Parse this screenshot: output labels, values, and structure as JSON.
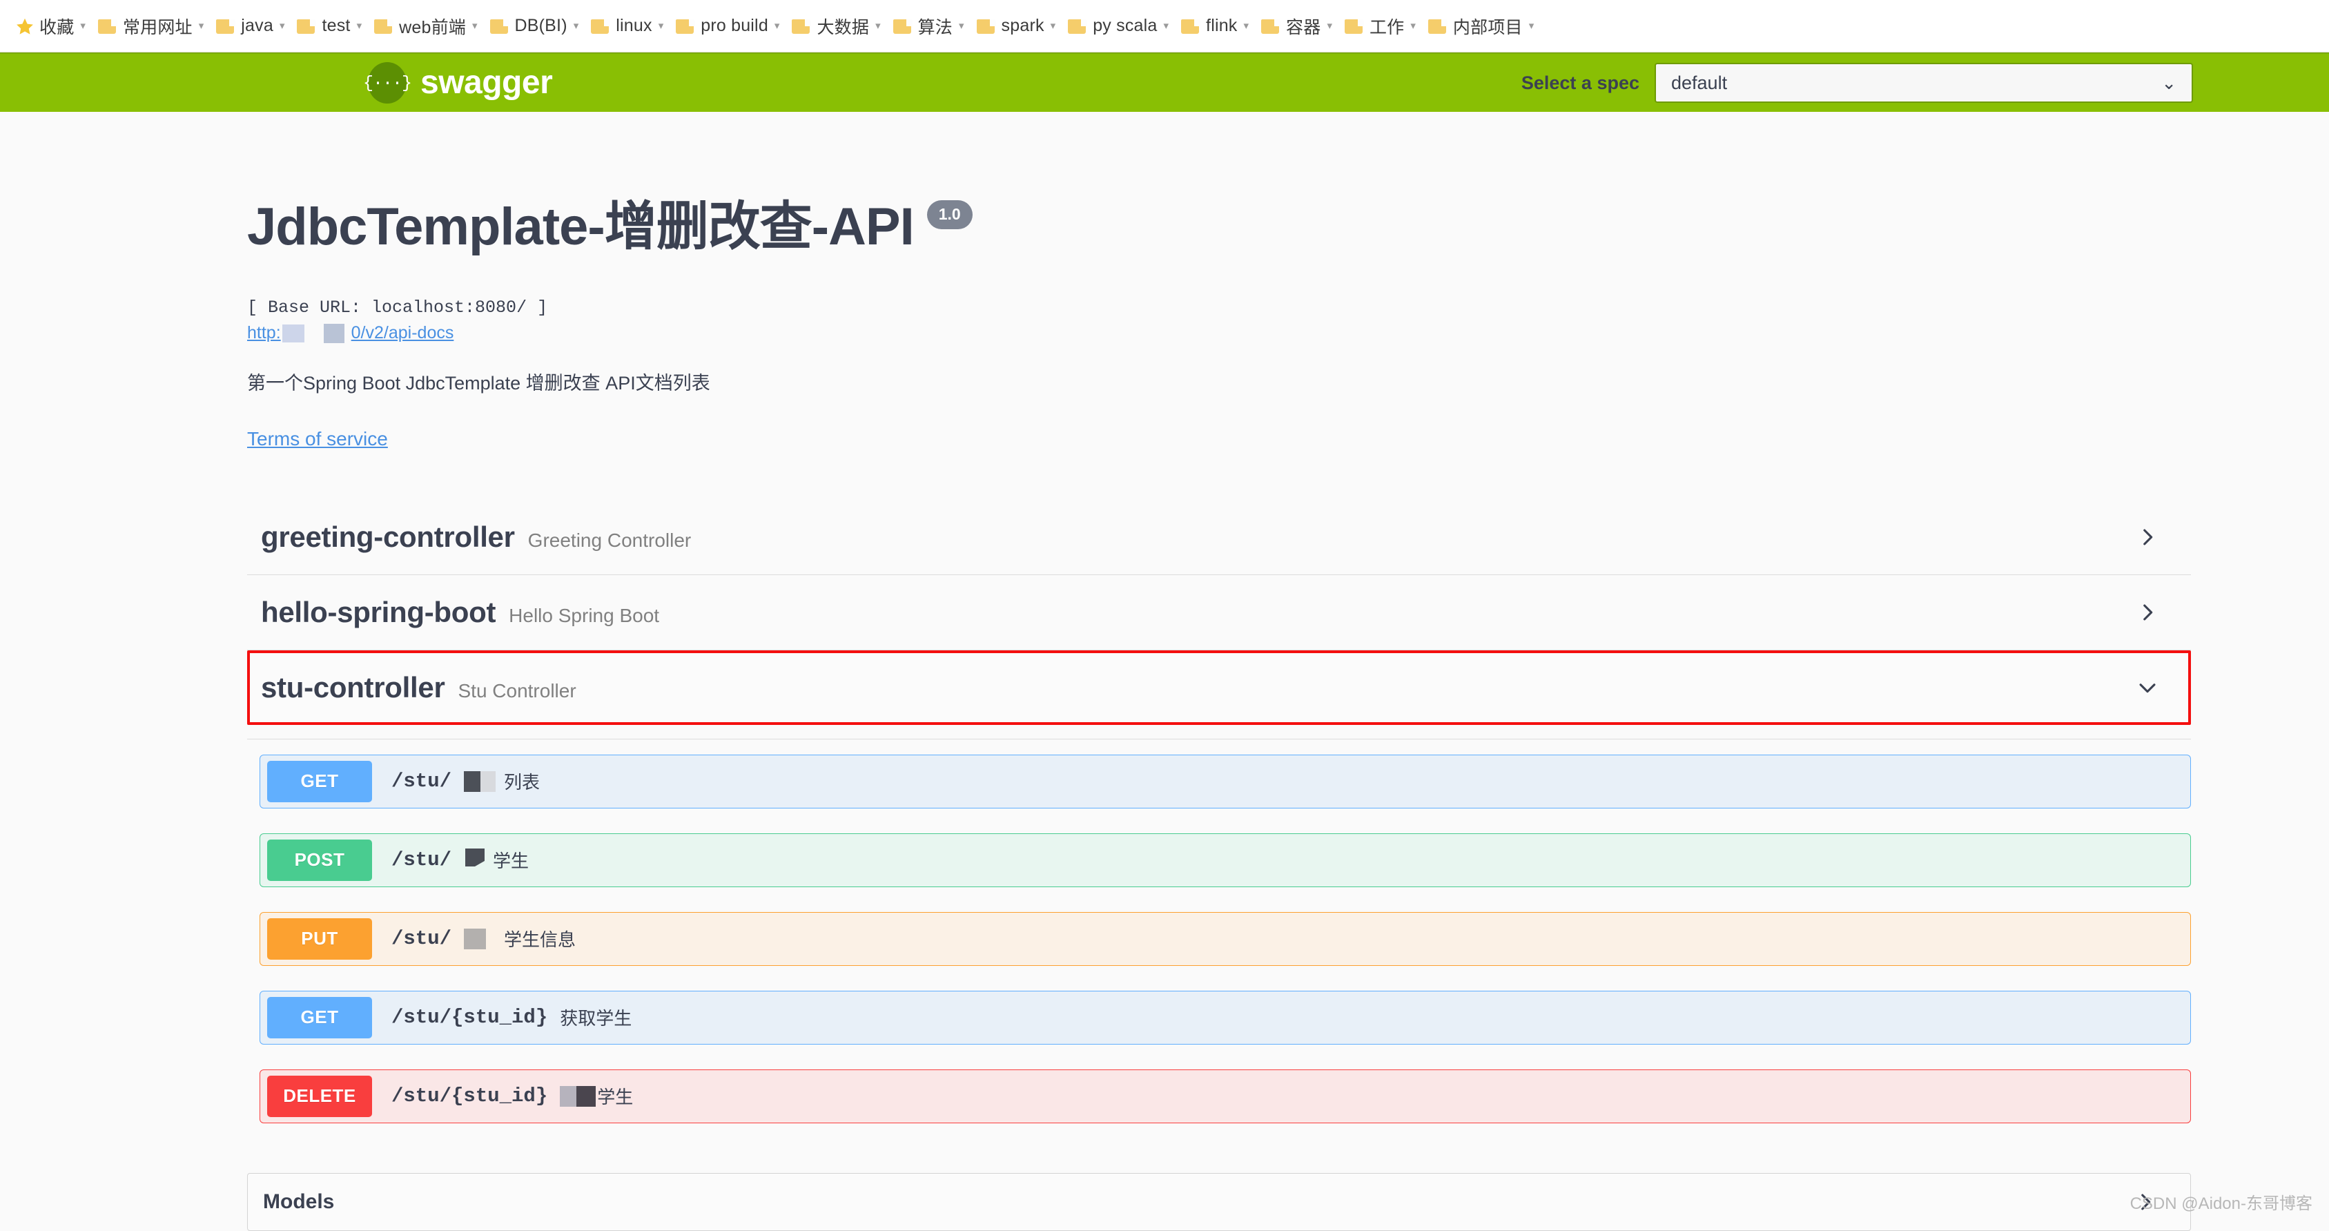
{
  "browser": {
    "bookmarks": [
      {
        "label": "收藏",
        "icon": "star-icon",
        "has_caret": true
      },
      {
        "label": "常用网址",
        "icon": "folder-icon",
        "has_caret": true
      },
      {
        "label": "java",
        "icon": "folder-icon",
        "has_caret": true
      },
      {
        "label": "test",
        "icon": "folder-icon",
        "has_caret": true
      },
      {
        "label": "web前端",
        "icon": "folder-icon",
        "has_caret": true
      },
      {
        "label": "DB(BI)",
        "icon": "folder-icon",
        "has_caret": true
      },
      {
        "label": "linux",
        "icon": "folder-icon",
        "has_caret": true
      },
      {
        "label": "pro build",
        "icon": "folder-icon",
        "has_caret": true
      },
      {
        "label": "大数据",
        "icon": "folder-icon",
        "has_caret": true
      },
      {
        "label": "算法",
        "icon": "folder-icon",
        "has_caret": true
      },
      {
        "label": "spark",
        "icon": "folder-icon",
        "has_caret": true
      },
      {
        "label": "py scala",
        "icon": "folder-icon",
        "has_caret": true
      },
      {
        "label": "flink",
        "icon": "folder-icon",
        "has_caret": true
      },
      {
        "label": "容器",
        "icon": "folder-icon",
        "has_caret": true
      },
      {
        "label": "工作",
        "icon": "folder-icon",
        "has_caret": true
      },
      {
        "label": "内部项目",
        "icon": "folder-icon",
        "has_caret": true
      }
    ]
  },
  "topbar": {
    "logo_glyph": "{···}",
    "logo_text": "swagger",
    "spec_label": "Select a spec",
    "spec_selected": "default",
    "spec_options": [
      "default"
    ],
    "bg_color": "#89bf04"
  },
  "info": {
    "title": "JdbcTemplate-增删改查-API",
    "version": "1.0",
    "base_url": "[ Base URL: localhost:8080/ ]",
    "docs_link_prefix": "http:",
    "docs_link_suffix": "0/v2/api-docs",
    "description": "第一个Spring Boot JdbcTemplate 增删改查 API文档列表",
    "terms_of_service": "Terms of service"
  },
  "tags": [
    {
      "name": "greeting-controller",
      "description": "Greeting Controller",
      "expanded": false,
      "chevron": "chevron-right-icon"
    },
    {
      "name": "hello-spring-boot",
      "description": "Hello Spring Boot",
      "expanded": false,
      "chevron": "chevron-right-icon"
    },
    {
      "name": "stu-controller",
      "description": "Stu Controller",
      "expanded": true,
      "chevron": "chevron-down-icon",
      "highlight_color": "#f40f0f"
    }
  ],
  "operations": [
    {
      "method": "GET",
      "path": "/stu/",
      "summary": "列表",
      "redacted": true,
      "method_color": "#61affe",
      "row_bg": "#e8f0f8"
    },
    {
      "method": "POST",
      "path": "/stu/",
      "summary": "学生",
      "redacted": true,
      "method_color": "#49cc90",
      "row_bg": "#e8f6f0"
    },
    {
      "method": "PUT",
      "path": "/stu/",
      "summary": "学生信息",
      "redacted": true,
      "method_color": "#fca130",
      "row_bg": "#fbf1e6"
    },
    {
      "method": "GET",
      "path": "/stu/{stu_id}",
      "summary": "获取学生",
      "redacted": false,
      "method_color": "#61affe",
      "row_bg": "#e8f0f8"
    },
    {
      "method": "DELETE",
      "path": "/stu/{stu_id}",
      "summary": "学生",
      "redacted": true,
      "method_color": "#f93e3e",
      "row_bg": "#fae7e7"
    }
  ],
  "models": {
    "title": "Models",
    "chevron": "chevron-right-icon"
  },
  "watermark": "CSDN @Aidon-东哥博客"
}
